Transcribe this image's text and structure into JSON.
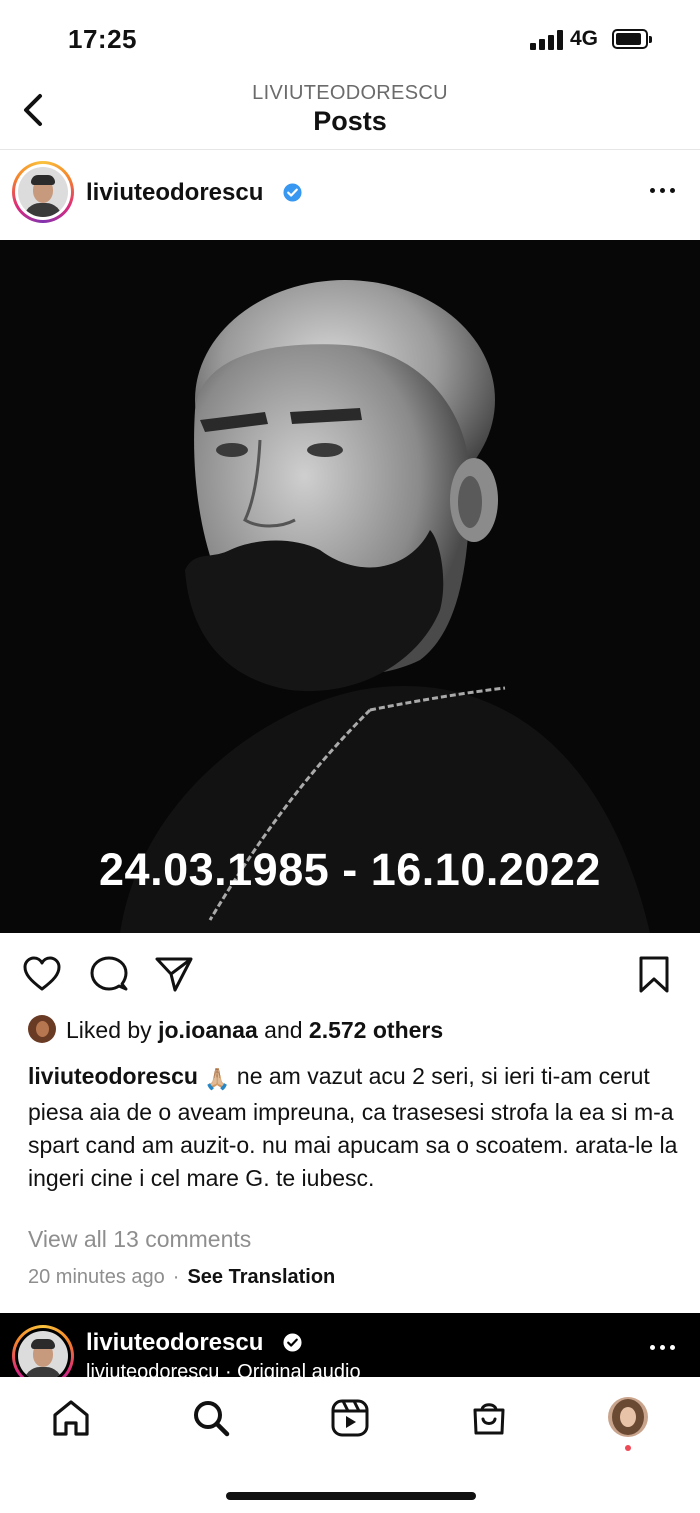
{
  "status_bar": {
    "time": "17:25",
    "network": "4G"
  },
  "header": {
    "username": "LIVIUTEODORESCU",
    "title": "Posts"
  },
  "post": {
    "username": "liviuteodorescu",
    "image_caption": "24.03.1985 - 16.10.2022",
    "likes": {
      "prefix": "Liked by",
      "liker": "jo.ioanaa",
      "middle": "and",
      "others": "2.572 others"
    },
    "caption_text": "ne am vazut acu 2 seri, si ieri ti-am cerut piesa aia de o aveam impreuna, ca trasesesi strofa la ea si m-a spart cand am auzit-o. nu mai apucam sa o scoatem. arata-le la ingeri cine i cel mare G. te iubesc.",
    "caption_emoji": "🙏🏼",
    "view_comments": "View all 13 comments",
    "timestamp": "20 minutes ago",
    "separator": "·",
    "see_translation": "See Translation"
  },
  "next_post": {
    "username": "liviuteodorescu",
    "audio": "liviuteodorescu · Original audio"
  },
  "icons": {
    "back": "chevron-left-icon",
    "verified": "verified-badge-icon",
    "more": "more-horizontal-icon",
    "like": "heart-icon",
    "comment": "comment-icon",
    "share": "send-icon",
    "save": "bookmark-icon",
    "home": "home-icon",
    "search": "search-icon",
    "reels": "reels-icon",
    "shop": "shop-icon",
    "profile": "profile-avatar"
  },
  "colors": {
    "verified": "#3897f0",
    "notification_dot": "#ed4956",
    "muted_text": "#8e8e8e"
  }
}
